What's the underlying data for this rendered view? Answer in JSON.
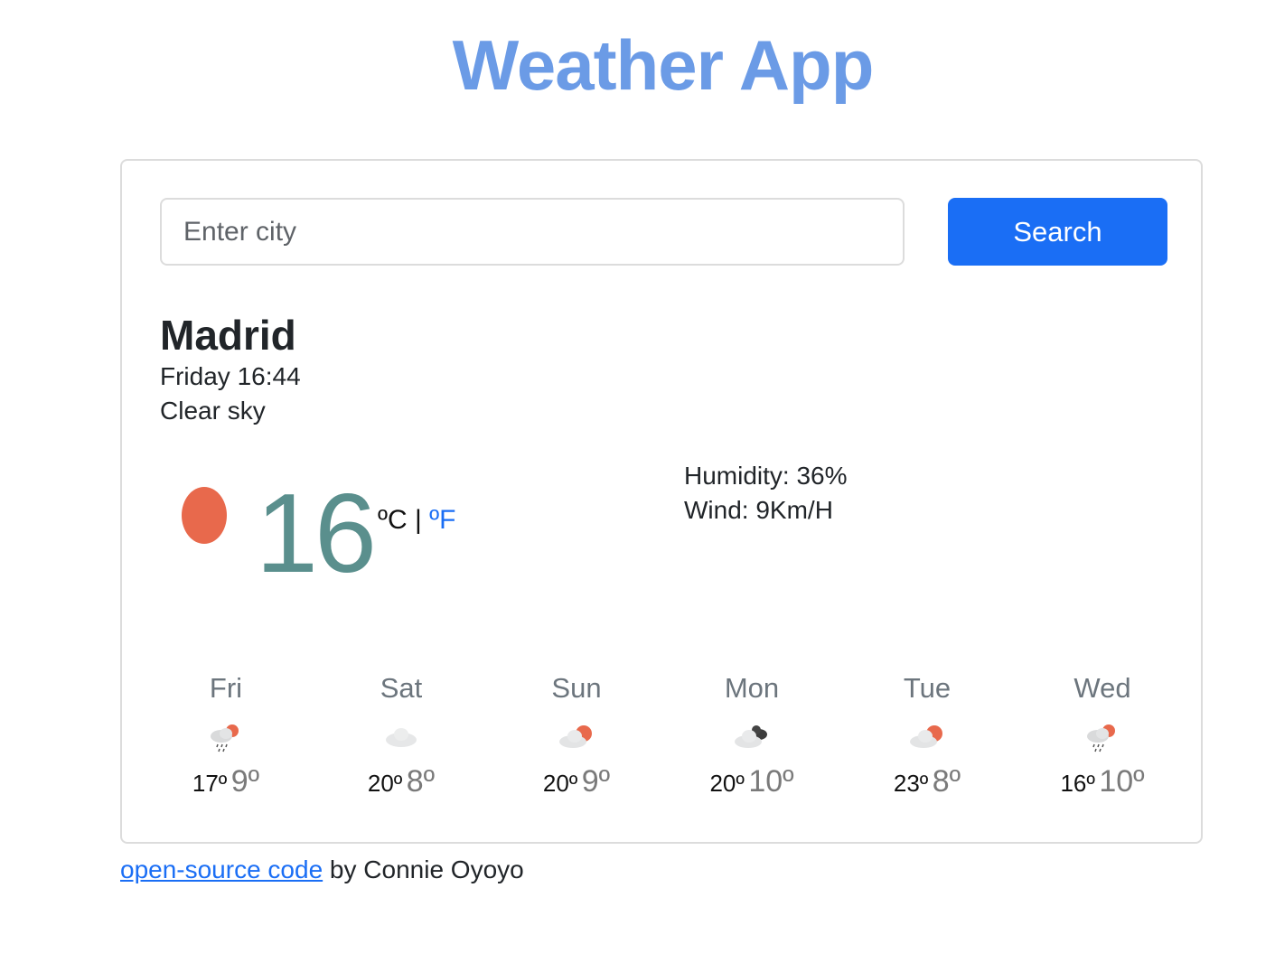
{
  "app": {
    "title": "Weather App"
  },
  "search": {
    "placeholder": "Enter city",
    "value": "",
    "button_label": "Search"
  },
  "current": {
    "city": "Madrid",
    "datetime": "Friday 16:44",
    "description": "Clear sky",
    "icon": "sun-icon",
    "temperature": "16",
    "unit_c": "ºC",
    "unit_separator": "|",
    "unit_f": "ºF",
    "humidity": "Humidity: 36%",
    "wind": "Wind: 9Km/H"
  },
  "forecast": [
    {
      "day": "Fri",
      "icon": "rain-cloud-sun-icon",
      "max": "17º",
      "min": "9º"
    },
    {
      "day": "Sat",
      "icon": "cloud-icon",
      "max": "20º",
      "min": "8º"
    },
    {
      "day": "Sun",
      "icon": "cloud-sun-icon",
      "max": "20º",
      "min": "9º"
    },
    {
      "day": "Mon",
      "icon": "dark-cloud-icon",
      "max": "20º",
      "min": "10º"
    },
    {
      "day": "Tue",
      "icon": "cloud-sun-icon",
      "max": "23º",
      "min": "8º"
    },
    {
      "day": "Wed",
      "icon": "rain-cloud-sun-icon",
      "max": "16º",
      "min": "10º"
    }
  ],
  "footer": {
    "link_text": "open-source code",
    "by_text": " by Connie Oyoyo"
  },
  "colors": {
    "title": "#6b9be6",
    "accent": "#1a6ef5",
    "temperature": "#5a8f8d",
    "sun": "#e8694c"
  }
}
